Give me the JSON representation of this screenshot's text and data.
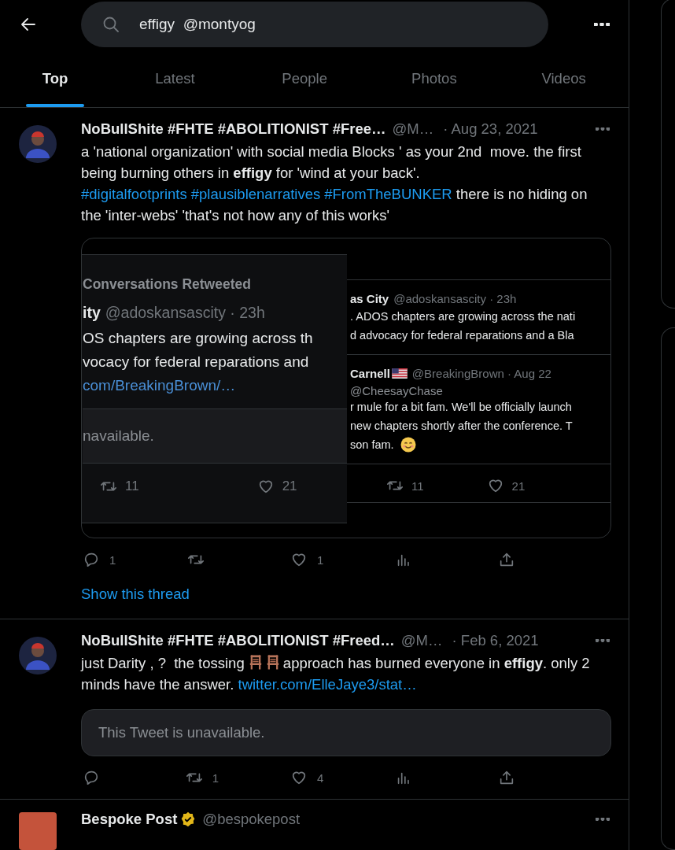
{
  "header": {
    "search": {
      "value": "effigy  @montyog"
    }
  },
  "tabs": [
    {
      "label": "Top",
      "selected": true
    },
    {
      "label": "Latest",
      "selected": false
    },
    {
      "label": "People",
      "selected": false
    },
    {
      "label": "Photos",
      "selected": false
    },
    {
      "label": "Videos",
      "selected": false
    }
  ],
  "tweets": [
    {
      "avatar": {
        "kind": "person"
      },
      "name": "NoBullShite #FHTE #ABOLITIONIST #Free…",
      "verified": false,
      "handle": "@M…",
      "date": "· Aug 23, 2021",
      "body": [
        {
          "kind": "text",
          "text": "a 'national organization' with social media Blocks ' as your 2nd  move. the first being burning others in **effigy** for 'wind at your back'. "
        },
        {
          "kind": "hashtag",
          "text": "#digitalfootprints"
        },
        {
          "kind": "hashtag",
          "text": "#plausiblenarratives"
        },
        {
          "kind": "hashtag",
          "text": "#FromTheBUNKER"
        },
        {
          "kind": "text",
          "text": " there is no hiding on the 'inter-webs' 'that's not how any of this works'"
        }
      ],
      "media": {
        "kind": "screenshot",
        "left": {
          "header": "Conversations Retweeted",
          "author": "ity",
          "meta": "@adoskansascity · 23h",
          "lines": [
            "OS chapters are growing across th",
            "vocacy for federal reparations and"
          ],
          "link": "com/BreakingBrown/…",
          "quote": "navailable.",
          "retweets": "11",
          "likes": "21"
        },
        "right": {
          "tweets": [
            {
              "author": "as City",
              "flag": false,
              "meta": "@adoskansascity · 23h",
              "lines": [
                ". ADOS chapters are growing across the nati",
                "d advocacy for federal reparations and a Bla"
              ]
            },
            {
              "author": "Carnell",
              "flag": true,
              "meta": "@BreakingBrown · Aug 22",
              "reply": "@CheesayChase",
              "lines": [
                "r mule for a bit fam. We'll be officially launch",
                "new chapters shortly after the conference. T",
                "son fam."
              ],
              "emoji": true
            }
          ],
          "retweets": "11",
          "likes": "21"
        }
      },
      "actions": [
        {
          "kind": "reply",
          "count": "1"
        },
        {
          "kind": "retweet"
        },
        {
          "kind": "like",
          "count": "1"
        },
        {
          "kind": "views"
        },
        {
          "kind": "share"
        }
      ],
      "thread_link": "Show this thread"
    },
    {
      "avatar": {
        "kind": "person"
      },
      "name": "NoBullShite #FHTE #ABOLITIONIST #Freed…",
      "verified": false,
      "handle": "@M…",
      "date": "· Feb 6, 2021",
      "body": [
        {
          "kind": "text",
          "text": "just Darity , ?  the tossing "
        },
        {
          "kind": "chair"
        },
        {
          "kind": "chair"
        },
        {
          "kind": "text",
          "text": "approach has burned everyone in **effigy**. only 2 minds have the answer. "
        },
        {
          "kind": "link",
          "text": "twitter.com/ElleJaye3/stat…"
        }
      ],
      "quote": {
        "text": "This Tweet is unavailable."
      },
      "actions": [
        {
          "kind": "reply"
        },
        {
          "kind": "retweet",
          "count": "1"
        },
        {
          "kind": "like",
          "count": "4"
        },
        {
          "kind": "views"
        },
        {
          "kind": "share"
        }
      ]
    },
    {
      "avatar": {
        "kind": "logo"
      },
      "name": "Bespoke Post",
      "verified": true,
      "handle": "@bespokepost"
    }
  ]
}
